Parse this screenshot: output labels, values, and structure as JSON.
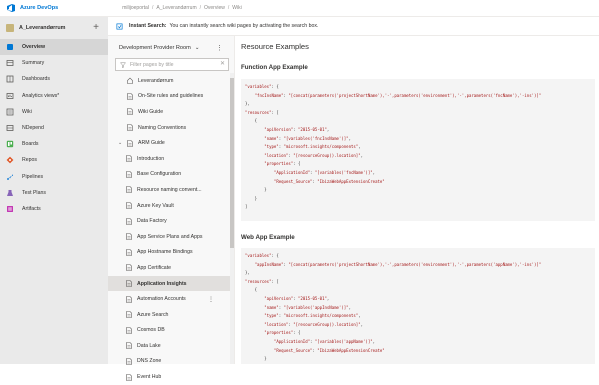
{
  "topbar": {
    "brand": "Azure DevOps",
    "breadcrumbs": [
      "milijoeportal",
      "A_Leverandørrum",
      "Overview",
      "Wiki"
    ]
  },
  "banner": {
    "bold": "Instant Search:",
    "text": "You can instantly search wiki pages by activating the search box."
  },
  "project": {
    "name": "A_Leverandørrum",
    "add": "+"
  },
  "nav": [
    {
      "label": "Overview",
      "icon": "overview-icon",
      "color": "#0078d4"
    },
    {
      "label": "Summary",
      "icon": "summary-icon",
      "color": "#605e5c"
    },
    {
      "label": "Dashboards",
      "icon": "dashboards-icon",
      "color": "#605e5c"
    },
    {
      "label": "Analytics views*",
      "icon": "analytics-icon",
      "color": "#605e5c"
    },
    {
      "label": "Wiki",
      "icon": "wiki-icon",
      "color": "#605e5c"
    },
    {
      "label": "NDepend",
      "icon": "ndepend-icon",
      "color": "#605e5c"
    },
    {
      "label": "Boards",
      "icon": "boards-icon",
      "color": "#4caf50"
    },
    {
      "label": "Repos",
      "icon": "repos-icon",
      "color": "#e05a2b"
    },
    {
      "label": "Pipelines",
      "icon": "pipelines-icon",
      "color": "#2b88d8"
    },
    {
      "label": "Test Plans",
      "icon": "test-plans-icon",
      "color": "#8764b8"
    },
    {
      "label": "Artifacts",
      "icon": "artifacts-icon",
      "color": "#c239b3"
    }
  ],
  "wiki": {
    "selector": "Development Provider Room",
    "filter_placeholder": "Filter pages by title",
    "pages": [
      {
        "label": "Leverandørrum",
        "level": 0,
        "home": true
      },
      {
        "label": "On-Site rules and guidelines",
        "level": 0
      },
      {
        "label": "Wiki Guide",
        "level": 0
      },
      {
        "label": "Naming Conventions",
        "level": 0
      },
      {
        "label": "ARM Guide",
        "level": 0,
        "expanded": true
      },
      {
        "label": "Introduction",
        "level": 1
      },
      {
        "label": "Base Configuration",
        "level": 1
      },
      {
        "label": "Resource naming convent...",
        "level": 1
      },
      {
        "label": "Azure Key Vault",
        "level": 1
      },
      {
        "label": "Data Factory",
        "level": 1
      },
      {
        "label": "App Service Plans and Apps",
        "level": 1
      },
      {
        "label": "App Hostname Bindings",
        "level": 1
      },
      {
        "label": "App Certificate",
        "level": 1
      },
      {
        "label": "Application Insights",
        "level": 1,
        "selected": true
      },
      {
        "label": "Automation Accounts",
        "level": 1,
        "more": true
      },
      {
        "label": "Azure Search",
        "level": 1
      },
      {
        "label": "Cosmos DB",
        "level": 1
      },
      {
        "label": "Data Lake",
        "level": 1
      },
      {
        "label": "DNS Zone",
        "level": 1
      },
      {
        "label": "Event Hub",
        "level": 1
      }
    ]
  },
  "content": {
    "title": "Resource Examples",
    "sections": [
      {
        "heading": "Function App Example",
        "lines": [
          "\"variables\": {",
          "    \"fncInsName\": \"[concat(parameters('projectShortName'),'-',parameters('environment'),'-',parameters('fncName'),'-ins')]\"",
          "},",
          "\"resources\": [",
          "    {",
          "        \"apiVersion\": \"2015-05-01\",",
          "        \"name\": \"[variables('fncInsName')]\",",
          "        \"type\": \"microsoft.insights/components\",",
          "        \"location\": \"[resourceGroup().location]\",",
          "        \"properties\": {",
          "            \"ApplicationId\": \"[variables('fncName')]\",",
          "            \"Request_Source\": \"IbizaWebAppExtensionCreate\"",
          "        }",
          "    }",
          "]"
        ]
      },
      {
        "heading": "Web App Example",
        "lines": [
          "\"variables\": {",
          "    \"appInsName\": \"[concat(parameters('projectShortName'),'-',parameters('environment'),'-',parameters('appName'),'-ins')]\"",
          "},",
          "\"resources\": [",
          "    {",
          "        \"apiVersion\": \"2015-05-01\",",
          "        \"name\": \"[variables('appInsName')]\",",
          "        \"type\": \"microsoft.insights/components\",",
          "        \"location\": \"[resourceGroup().location]\",",
          "        \"properties\": {",
          "            \"ApplicationId\": \"[variables('appName')]\",",
          "            \"Request_Source\": \"IbizaWebAppExtensionCreate\"",
          "        }"
        ]
      }
    ]
  }
}
